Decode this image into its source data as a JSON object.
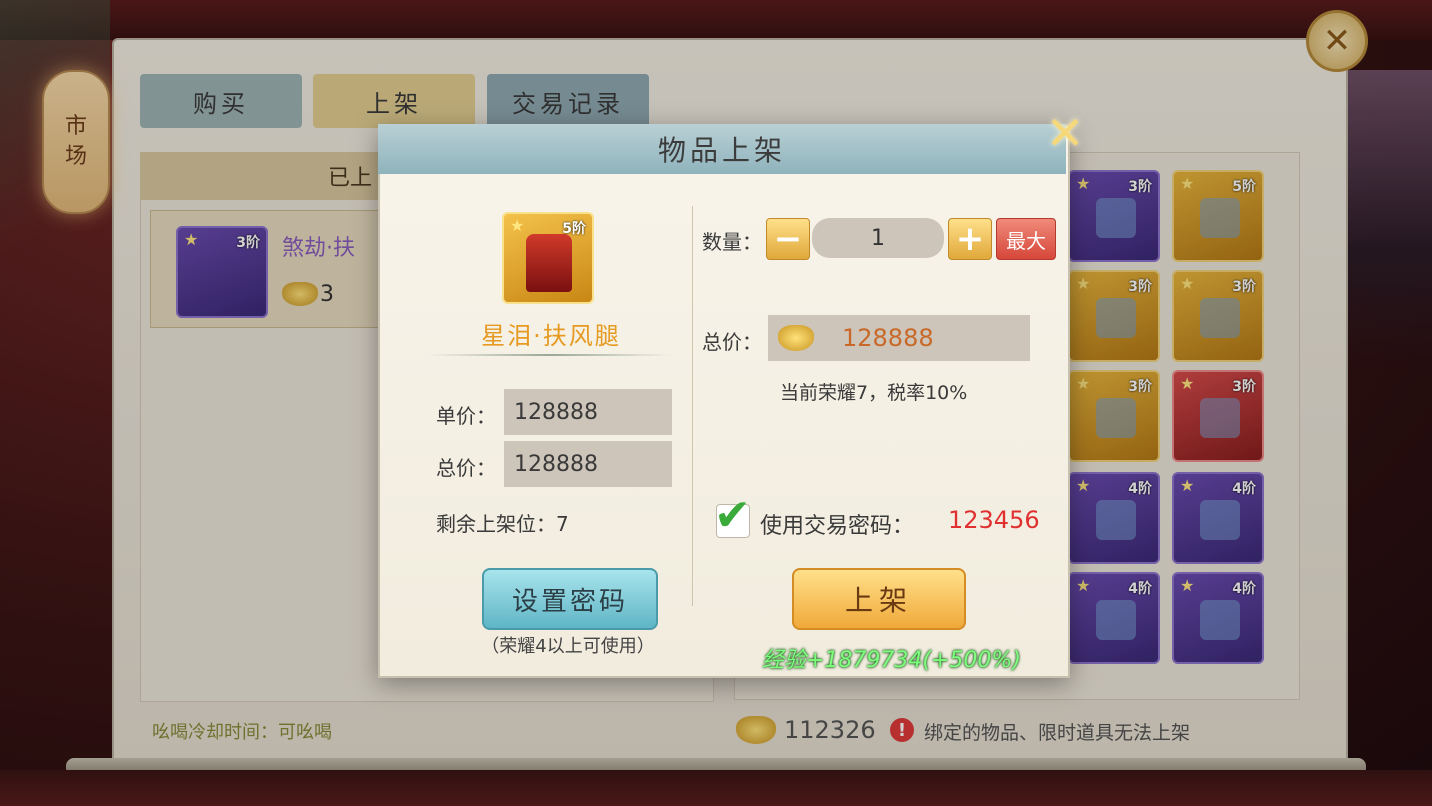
{
  "market_tab": {
    "label_line1": "市",
    "label_line2": "场"
  },
  "top_tabs": [
    {
      "label": "购买"
    },
    {
      "label": "上架"
    },
    {
      "label": "交易记录"
    }
  ],
  "listed_pane": {
    "header": "已上",
    "item": {
      "name": "煞劫·扶",
      "tier": "3阶",
      "price": "3"
    }
  },
  "shout_cooldown": "吆喝冷却时间：可吆喝",
  "inventory": {
    "items": [
      {
        "tier": "3阶",
        "quality": "purple",
        "icon": "armor-icon"
      },
      {
        "tier": "5阶",
        "quality": "gold",
        "icon": "armor-icon"
      },
      {
        "tier": "3阶",
        "quality": "gold",
        "icon": "pants-icon"
      },
      {
        "tier": "3阶",
        "quality": "gold",
        "icon": "pants-icon"
      },
      {
        "tier": "3阶",
        "quality": "gold",
        "icon": "helmet-icon"
      },
      {
        "tier": "3阶",
        "quality": "red",
        "icon": "boots-icon"
      },
      {
        "tier": "4阶",
        "quality": "purple",
        "icon": "gem-icon"
      },
      {
        "tier": "4阶",
        "quality": "purple",
        "icon": "helmet-icon"
      },
      {
        "tier": "4阶",
        "quality": "purple",
        "icon": "belt-icon"
      },
      {
        "tier": "4阶",
        "quality": "purple",
        "icon": "gem-icon"
      }
    ]
  },
  "footer": {
    "gold_amount": "112326",
    "warning": "绑定的物品、限时道具无法上架"
  },
  "dialog": {
    "title": "物品上架",
    "item_name": "星泪·扶风腿",
    "item_tier": "5阶",
    "unit_price_label": "单价：",
    "unit_price": "128888",
    "total_price_label": "总价：",
    "total_price": "128888",
    "remaining_slots": "剩余上架位：7",
    "set_password_button": "设置密码",
    "set_password_note": "（荣耀4以上可使用）",
    "quantity_label": "数量：",
    "quantity": "1",
    "minus": "−",
    "plus": "+",
    "max_button": "最大",
    "summary_total_label": "总价：",
    "summary_total": "128888",
    "tax_note": "当前荣耀7，税率10%",
    "use_password_label": "使用交易密码：",
    "password": "123456",
    "list_button": "上架",
    "exp_text": "经验+1879734(+500%)"
  },
  "colors": {
    "accent_gold": "#e69a22",
    "password_red": "#e03030",
    "exp_green": "#7cff7c",
    "max_button": "#d6473a"
  }
}
